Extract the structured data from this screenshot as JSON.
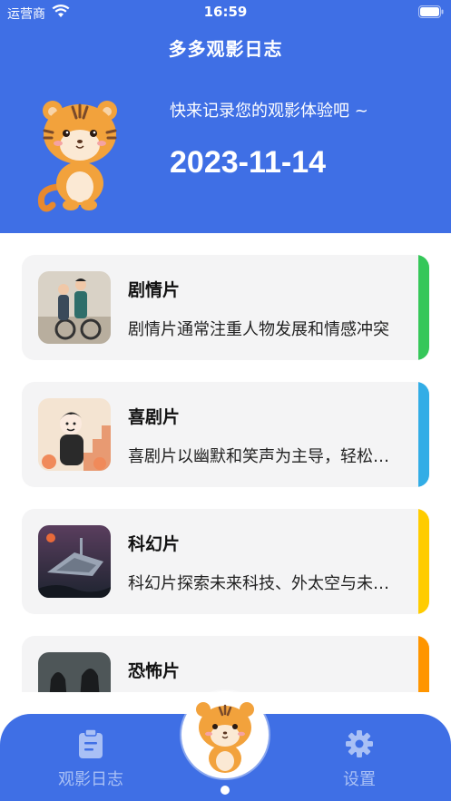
{
  "status": {
    "carrier": "运营商",
    "time": "16:59"
  },
  "header": {
    "title": "多多观影日志",
    "tagline": "快来记录您的观影体验吧 ~",
    "date": "2023-11-14",
    "bg_color": "#3F6FE5"
  },
  "genres": [
    {
      "title": "剧情片",
      "desc": "剧情片通常注重人物发展和情感冲突",
      "accent": "#35C759"
    },
    {
      "title": "喜剧片",
      "desc": "喜剧片以幽默和笑声为主导，轻松愉快",
      "accent": "#32ADE6"
    },
    {
      "title": "科幻片",
      "desc": "科幻片探索未来科技、外太空与未知世界",
      "accent": "#FFCC00"
    },
    {
      "title": "恐怖片",
      "desc": "",
      "accent": "#FF9500"
    }
  ],
  "tabbar": {
    "left_label": "观影日志",
    "right_label": "设置",
    "left_icon": "clipboard-icon",
    "right_icon": "gear-icon",
    "center_icon": "tiger-mascot-icon"
  }
}
